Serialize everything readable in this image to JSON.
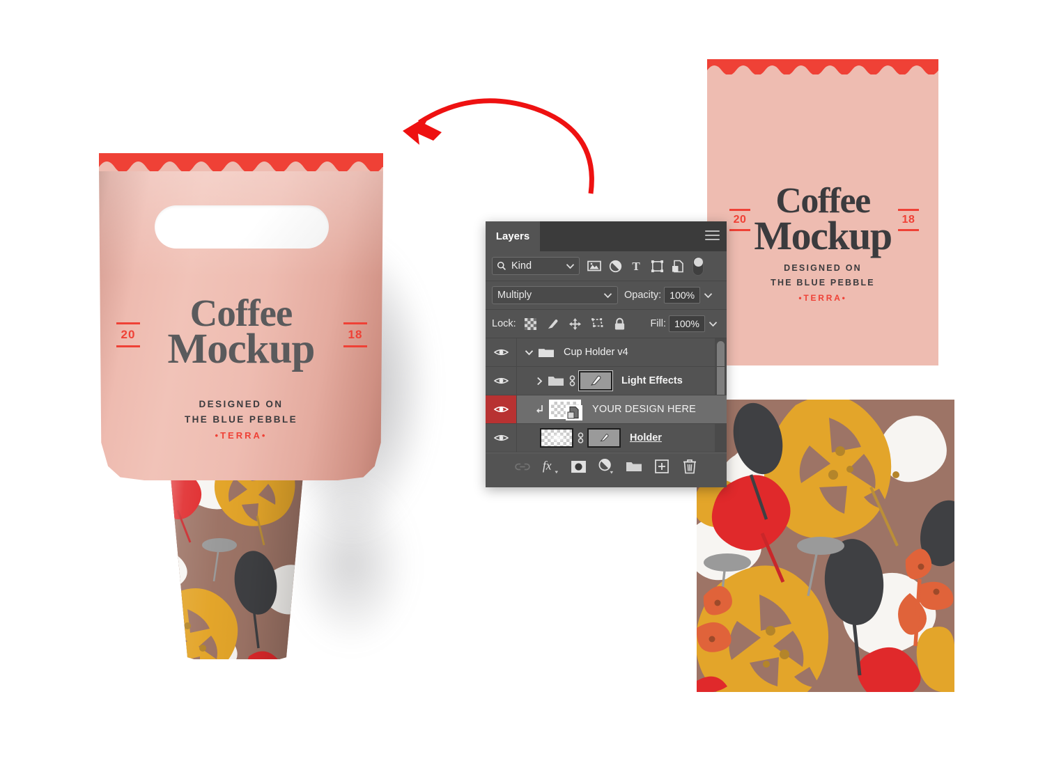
{
  "document": {
    "brand": {
      "title_line1": "Coffee",
      "title_line2": "Mockup",
      "year_left": "20",
      "year_right": "18",
      "tagline_line1": "DESIGNED ON",
      "tagline_line2": "THE BLUE PEBBLE",
      "tagline_line3": "•TERRA•"
    },
    "colors": {
      "holder_pink": "#eebcb1",
      "accent_red": "#ef4136",
      "scallop_red": "#ef4136",
      "text_dark": "#3b3b3e",
      "pattern_bg": "#9d7466",
      "pattern_gold": "#e3a52a",
      "pattern_white": "#f7f5f2",
      "pattern_charcoal": "#3f4043",
      "pattern_red": "#e0292b",
      "pattern_orange": "#e0633a",
      "pattern_grey": "#9a9a9a"
    }
  },
  "annotation": {
    "arrow_name": "curved-arrow-left",
    "arrow_color": "#ee1111"
  },
  "layers_panel": {
    "tab_label": "Layers",
    "menu_icon": "hamburger-menu-icon",
    "filter": {
      "search_icon": "search-icon",
      "kind_label": "Kind",
      "chevron": "chevron-down-icon",
      "icons": [
        "pixel-layer-icon",
        "adjustment-layer-icon",
        "type-layer-icon",
        "shape-layer-icon",
        "smart-object-icon"
      ],
      "toggle_name": "filter-enable-toggle"
    },
    "blend": {
      "mode": "Multiply",
      "chevron": "chevron-down-icon",
      "opacity_label": "Opacity:",
      "opacity_value": "100%",
      "opacity_chevron": "chevron-down-icon"
    },
    "lock": {
      "label": "Lock:",
      "icons": [
        "lock-transparency-icon",
        "lock-image-icon",
        "lock-position-icon",
        "lock-artboard-icon",
        "lock-all-icon"
      ],
      "fill_label": "Fill:",
      "fill_value": "100%",
      "fill_chevron": "chevron-down-icon"
    },
    "layers": [
      {
        "name": "Cup Holder v4",
        "type": "group",
        "visible": true,
        "expanded": true,
        "selected": false,
        "indent": 0,
        "twisty": "chevron-down-icon",
        "icon": "folder-open-icon"
      },
      {
        "name": "Light Effects",
        "type": "group",
        "visible": true,
        "expanded": false,
        "selected": false,
        "indent": 1,
        "twisty": "chevron-right-icon",
        "icon": "folder-icon",
        "link_icon": "link-mask-icon",
        "mask_icon": "layer-mask-thumbnail"
      },
      {
        "name": "YOUR DESIGN HERE",
        "type": "smart-object",
        "visible": true,
        "selected": true,
        "indent": 1,
        "clipping_icon": "clipping-mask-arrow-icon",
        "thumb": "transparent-smart-object-thumbnail"
      },
      {
        "name": "Holder",
        "type": "pixel",
        "visible": true,
        "selected": false,
        "underlined": true,
        "indent": 1,
        "thumb": "transparent-layer-thumbnail",
        "link_icon": "link-mask-icon",
        "mask_icon": "layer-mask-thumbnail"
      }
    ],
    "scrollbar": "layers-list-scrollbar",
    "footer_buttons": [
      {
        "name": "link-layers-button",
        "glyph": "link-icon",
        "enabled": false
      },
      {
        "name": "layer-style-button",
        "glyph": "fx-icon",
        "enabled": true
      },
      {
        "name": "add-layer-mask-button",
        "glyph": "mask-icon",
        "enabled": true
      },
      {
        "name": "new-adjustment-layer-button",
        "glyph": "half-circle-icon",
        "enabled": true
      },
      {
        "name": "new-group-button",
        "glyph": "folder-icon",
        "enabled": true
      },
      {
        "name": "new-layer-button",
        "glyph": "plus-square-icon",
        "enabled": true
      },
      {
        "name": "delete-layer-button",
        "glyph": "trash-icon",
        "enabled": true
      }
    ]
  }
}
